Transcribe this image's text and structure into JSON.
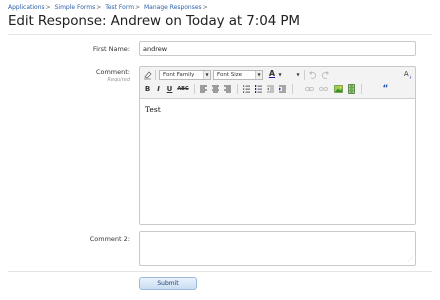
{
  "breadcrumb": [
    {
      "label": "Applications"
    },
    {
      "label": "Simple Forms"
    },
    {
      "label": "Test Form"
    },
    {
      "label": "Manage Responses"
    }
  ],
  "breadcrumb_separator": ">",
  "page_title": "Edit Response: Andrew on Today at 7:04 PM",
  "form": {
    "first_name_label": "First Name:",
    "first_name_value": "andrew",
    "comment_label": "Comment:",
    "comment_required": "Required",
    "comment2_label": "Comment 2:",
    "comment2_value": ""
  },
  "editor": {
    "font_family_label": "Font Family",
    "font_size_label": "Font Size",
    "content": "Test",
    "toolbar_row1": [
      "eraser-icon",
      "font-family-select",
      "font-size-select",
      "font-color-icon",
      "undo-icon",
      "redo-icon",
      "text-direction-icon"
    ],
    "toolbar_row2": [
      "bold-icon",
      "italic-icon",
      "underline-icon",
      "strikethrough-icon",
      "align-left-icon",
      "align-center-icon",
      "align-right-icon",
      "bullet-list-icon",
      "numbered-list-icon",
      "outdent-icon",
      "indent-icon",
      "link-icon",
      "unlink-icon",
      "image-icon",
      "media-icon",
      "quote-icon"
    ],
    "bold_glyph": "B",
    "italic_glyph": "I",
    "underline_glyph": "U",
    "strike_glyph": "ABC",
    "color_glyph": "A",
    "quote_glyph": "“",
    "text_dir_glyph": "A"
  },
  "submit_label": "Submit",
  "colors": {
    "link": "#2a5fa8",
    "button_border": "#9bb9dc",
    "button_text": "#1f3f6e"
  }
}
